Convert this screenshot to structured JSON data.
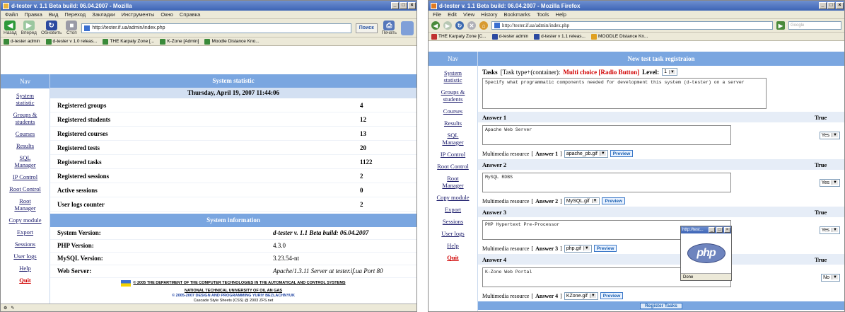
{
  "left": {
    "window_title": "d-tester v. 1.1 Beta build: 06.04.2007 - Mozilla",
    "menu": [
      "Файл",
      "Правка",
      "Вид",
      "Переход",
      "Закладки",
      "Инструменты",
      "Окно",
      "Справка"
    ],
    "toolbar": {
      "back": "Назад",
      "forward": "Вперед",
      "reload": "Обновить",
      "stop": "Стоп",
      "go": "Поиск",
      "print": "Печать"
    },
    "url": "http://tester.if.ua/admin/index.php",
    "bookmarks": [
      "d-tester admin",
      "d-tester v 1.0 releas...",
      "THE Karpaty Zone [...",
      "K-Zone [Admin]",
      "Moodle Distance Kno..."
    ],
    "nav_title": "Nav",
    "nav": [
      "System statistic",
      "Groups & students",
      "Courses",
      "Results",
      "SQL Manager",
      "IP Control",
      "Root Control",
      "Root Manager",
      "Copy module",
      "Export",
      "Sessions",
      "User logs",
      "Help",
      "Quit"
    ],
    "stat_title": "System statistic",
    "date": "Thursday, April 19, 2007 11:44:06",
    "stats": [
      {
        "label": "Registered groups",
        "value": "4"
      },
      {
        "label": "Registered students",
        "value": "12"
      },
      {
        "label": "Registered courses",
        "value": "13"
      },
      {
        "label": "Registered tests",
        "value": "20"
      },
      {
        "label": "Registered tasks",
        "value": "1122"
      },
      {
        "label": "Registered sessions",
        "value": "2"
      },
      {
        "label": "Active sessions",
        "value": "0"
      },
      {
        "label": "User logs counter",
        "value": "2"
      }
    ],
    "info_title": "System information",
    "info": [
      {
        "label": "System Version:",
        "value": "d-tester v. 1.1 Beta build: 06.04.2007"
      },
      {
        "label": "PHP Version:",
        "value": "4.3.0"
      },
      {
        "label": "MySQL Version:",
        "value": "3.23.54-nt"
      },
      {
        "label": "Web Server:",
        "value": "Apache/1.3.11 Server at tester.if.ua Port 80"
      }
    ],
    "footer": {
      "line1": "© 2005 THE DEPARTMENT OF THE COMPUTER TECHNOLOGIES IN THE AUTOMATICAL AND CONTROL SYSTEMS",
      "line2": "NATIONAL TECHNICAL UNIVERSITY OF OIL AN GAS",
      "line3": "© 2005-2007 DESIGN AND PROGRAMMING YURIY BEZLACHNYUK",
      "line4": "Cascade Style Sheets (CSS) @ 2003 ZFS.net"
    }
  },
  "right": {
    "window_title": "d-tester v. 1.1 Beta build: 06.04.2007 - Mozilla Firefox",
    "menu": [
      "File",
      "Edit",
      "View",
      "History",
      "Bookmarks",
      "Tools",
      "Help"
    ],
    "url": "http://tester.if.ua/admin/index.php",
    "search_placeholder": "Google",
    "bookmarks": [
      "THE Karpaty Zone [C...",
      "d-tester admin",
      "d-tester v 1.1 releas...",
      "MOODLE Distance Kn..."
    ],
    "nav_title": "Nav",
    "nav": [
      "System statistic",
      "Groups & students",
      "Courses",
      "Results",
      "SQL Manager",
      "IP Control",
      "Root Control",
      "Root Manager",
      "Copy module",
      "Export",
      "Sessions",
      "User logs",
      "Help",
      "Quit"
    ],
    "form_title": "New test task registraion",
    "tasks_label": "Tasks",
    "tasks_type": "[Task type+(container):",
    "tasks_type_value": "Multi choice [Radio Button]",
    "level_label": "Level:",
    "level_value": "1",
    "question": "Specify what programmatic components needed for development this system (d-tester) on a server",
    "true_label": "True",
    "mm_label": "Multimedia resource",
    "preview": "Preview",
    "answers": [
      {
        "label": "Answer 1",
        "text": "Apache Web Server",
        "truth": "Yes",
        "mm_tag": "Answer 1",
        "file": "apache_pb.gif"
      },
      {
        "label": "Answer 2",
        "text": "MySQL RDBS",
        "truth": "Yes",
        "mm_tag": "Answer 2",
        "file": "MySQL.gif"
      },
      {
        "label": "Answer 3",
        "text": "PHP Hypertext Pre-Processor",
        "truth": "Yes",
        "mm_tag": "Answer 3",
        "file": "php.gif"
      },
      {
        "label": "Answer 4",
        "text": "K-Zone Web Portal",
        "truth": "No",
        "mm_tag": "Answer 4",
        "file": "KZone.gif"
      }
    ],
    "register": "Register Tasks",
    "popup": {
      "title": "http://test...",
      "logo": "php",
      "status": "Done"
    }
  }
}
